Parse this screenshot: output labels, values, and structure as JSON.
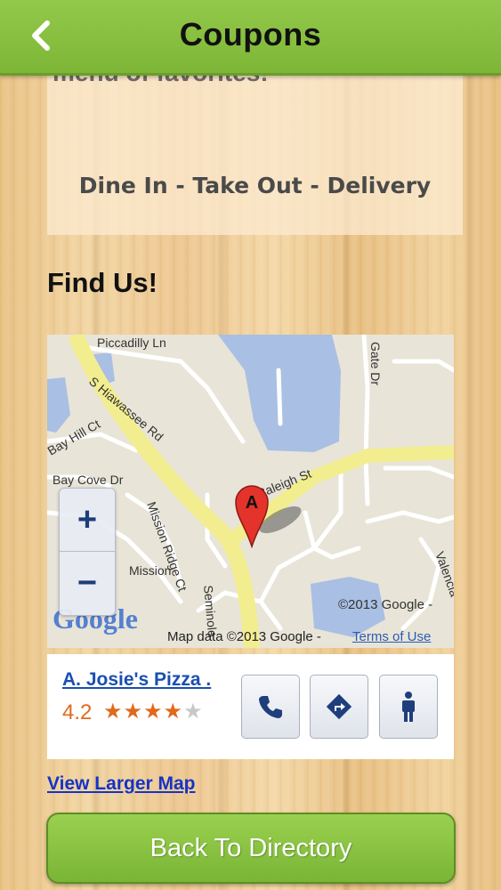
{
  "header": {
    "title": "Coupons",
    "back_icon": "chevron-left-icon"
  },
  "info": {
    "cut_text": "menu of favorites!",
    "service_text": "Dine In - Take Out - Delivery"
  },
  "find_us": "Find Us!",
  "map": {
    "streets": [
      "Piccadilly Ln",
      "S Hiawassee Rd",
      "Raleigh St",
      "Mission Ridge Ct",
      "Mission",
      "Bay Hill Ct",
      "Bay Cove Dr",
      "Gate Dr",
      "Valencia",
      "Seminole"
    ],
    "marker_label": "A",
    "zoom_in": "+",
    "zoom_out": "−",
    "logo": "Google",
    "copyright": "©2013 Google -",
    "attribution": "Map data ©2013 Google -",
    "terms": "Terms of Use"
  },
  "place": {
    "name": "A. Josie's Pizza .",
    "rating": "4.2",
    "stars_filled": 4,
    "stars_total": 5
  },
  "actions": [
    "phone-icon",
    "directions-icon",
    "person-icon"
  ],
  "view_larger": "View Larger Map",
  "back_to_directory": "Back To Directory",
  "colors": {
    "header_green": "#85bf3e",
    "link_blue": "#1433c8",
    "rating_orange": "#e06a1c"
  }
}
